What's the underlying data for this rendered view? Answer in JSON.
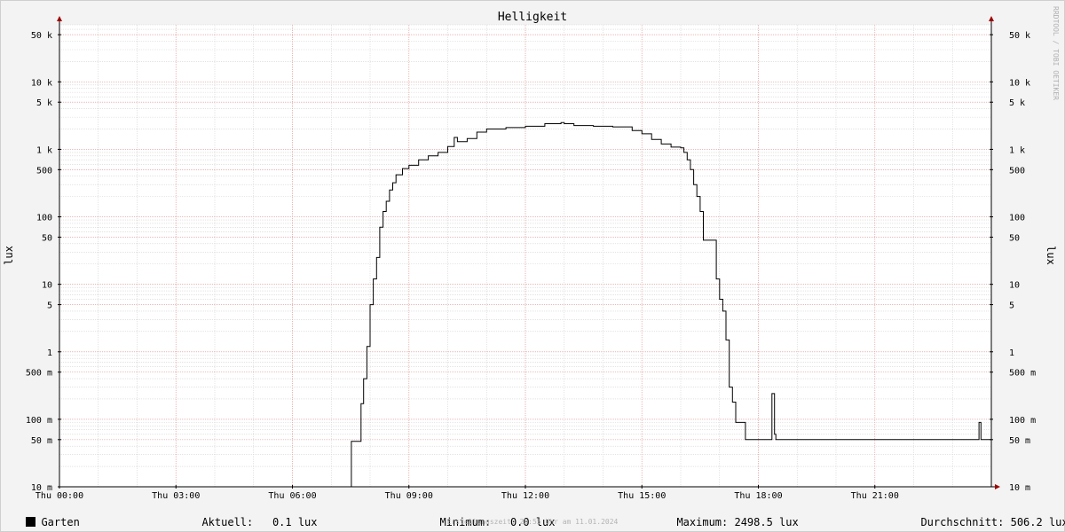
{
  "chart_data": {
    "type": "line",
    "title": "Helligkeit",
    "ylabel": "lux",
    "ylabel_right": "lux",
    "watermark": "RRDTOOL / TOBI OETIKER",
    "y_scale": "log",
    "ylim": [
      0.01,
      70000
    ],
    "y_ticks": [
      {
        "v": 50000,
        "label": "50 k"
      },
      {
        "v": 10000,
        "label": "10 k"
      },
      {
        "v": 5000,
        "label": "5 k"
      },
      {
        "v": 1000,
        "label": "1 k"
      },
      {
        "v": 500,
        "label": "500"
      },
      {
        "v": 100,
        "label": "100"
      },
      {
        "v": 50,
        "label": "50"
      },
      {
        "v": 10,
        "label": "10"
      },
      {
        "v": 5,
        "label": "5"
      },
      {
        "v": 1,
        "label": "1"
      },
      {
        "v": 0.5,
        "label": "500 m"
      },
      {
        "v": 0.1,
        "label": "100 m"
      },
      {
        "v": 0.05,
        "label": "50 m"
      },
      {
        "v": 0.01,
        "label": "10 m"
      }
    ],
    "xlim": [
      "00:00",
      "24:00"
    ],
    "x_ticks": [
      {
        "t": "00:00",
        "label": "Thu 00:00"
      },
      {
        "t": "03:00",
        "label": "Thu 03:00"
      },
      {
        "t": "06:00",
        "label": "Thu 06:00"
      },
      {
        "t": "09:00",
        "label": "Thu 09:00"
      },
      {
        "t": "12:00",
        "label": "Thu 12:00"
      },
      {
        "t": "15:00",
        "label": "Thu 15:00"
      },
      {
        "t": "18:00",
        "label": "Thu 18:00"
      },
      {
        "t": "21:00",
        "label": "Thu 21:00"
      }
    ],
    "grid": true,
    "series": [
      {
        "name": "Garten",
        "color": "#000000",
        "points": [
          [
            "00:00",
            0.01
          ],
          [
            "07:30",
            0.01
          ],
          [
            "07:31",
            0.047
          ],
          [
            "07:45",
            0.047
          ],
          [
            "07:46",
            0.17
          ],
          [
            "07:50",
            0.4
          ],
          [
            "07:55",
            1.2
          ],
          [
            "08:00",
            5
          ],
          [
            "08:05",
            12
          ],
          [
            "08:10",
            25
          ],
          [
            "08:15",
            70
          ],
          [
            "08:20",
            120
          ],
          [
            "08:25",
            170
          ],
          [
            "08:30",
            250
          ],
          [
            "08:35",
            320
          ],
          [
            "08:40",
            420
          ],
          [
            "08:50",
            520
          ],
          [
            "09:00",
            580
          ],
          [
            "09:15",
            700
          ],
          [
            "09:30",
            800
          ],
          [
            "09:45",
            900
          ],
          [
            "10:00",
            1100
          ],
          [
            "10:10",
            1500
          ],
          [
            "10:15",
            1300
          ],
          [
            "10:30",
            1450
          ],
          [
            "10:45",
            1800
          ],
          [
            "11:00",
            2000
          ],
          [
            "11:30",
            2100
          ],
          [
            "12:00",
            2200
          ],
          [
            "12:30",
            2400
          ],
          [
            "12:55",
            2498.5
          ],
          [
            "13:00",
            2400
          ],
          [
            "13:15",
            2250
          ],
          [
            "13:45",
            2200
          ],
          [
            "14:15",
            2150
          ],
          [
            "14:45",
            1900
          ],
          [
            "15:00",
            1700
          ],
          [
            "15:15",
            1400
          ],
          [
            "15:30",
            1200
          ],
          [
            "15:45",
            1080
          ],
          [
            "16:00",
            1050
          ],
          [
            "16:05",
            900
          ],
          [
            "16:10",
            700
          ],
          [
            "16:15",
            500
          ],
          [
            "16:20",
            300
          ],
          [
            "16:25",
            200
          ],
          [
            "16:30",
            120
          ],
          [
            "16:35",
            45
          ],
          [
            "16:55",
            12
          ],
          [
            "17:00",
            6
          ],
          [
            "17:05",
            4
          ],
          [
            "17:10",
            1.5
          ],
          [
            "17:15",
            0.3
          ],
          [
            "17:20",
            0.18
          ],
          [
            "17:25",
            0.09
          ],
          [
            "17:40",
            0.05
          ],
          [
            "18:20",
            0.05
          ],
          [
            "18:21",
            0.24
          ],
          [
            "18:25",
            0.06
          ],
          [
            "18:27",
            0.05
          ],
          [
            "23:40",
            0.05
          ],
          [
            "23:41",
            0.09
          ],
          [
            "23:44",
            0.05
          ],
          [
            "24:00",
            0.05
          ]
        ]
      }
    ]
  },
  "legend": {
    "series_name": "Garten",
    "current_label": "Aktuell:",
    "current_value": "0.1 lux",
    "min_label": "Minimum:",
    "min_value": "0.0 lux",
    "max_label": "Maximum:",
    "max_value": "2498.5 lux",
    "avg_label": "Durchschnitt:",
    "avg_value": "506.2 lux"
  },
  "footer": {
    "created": "Erstellungszeit: 23:55 Uhr am 11.01.2024"
  }
}
